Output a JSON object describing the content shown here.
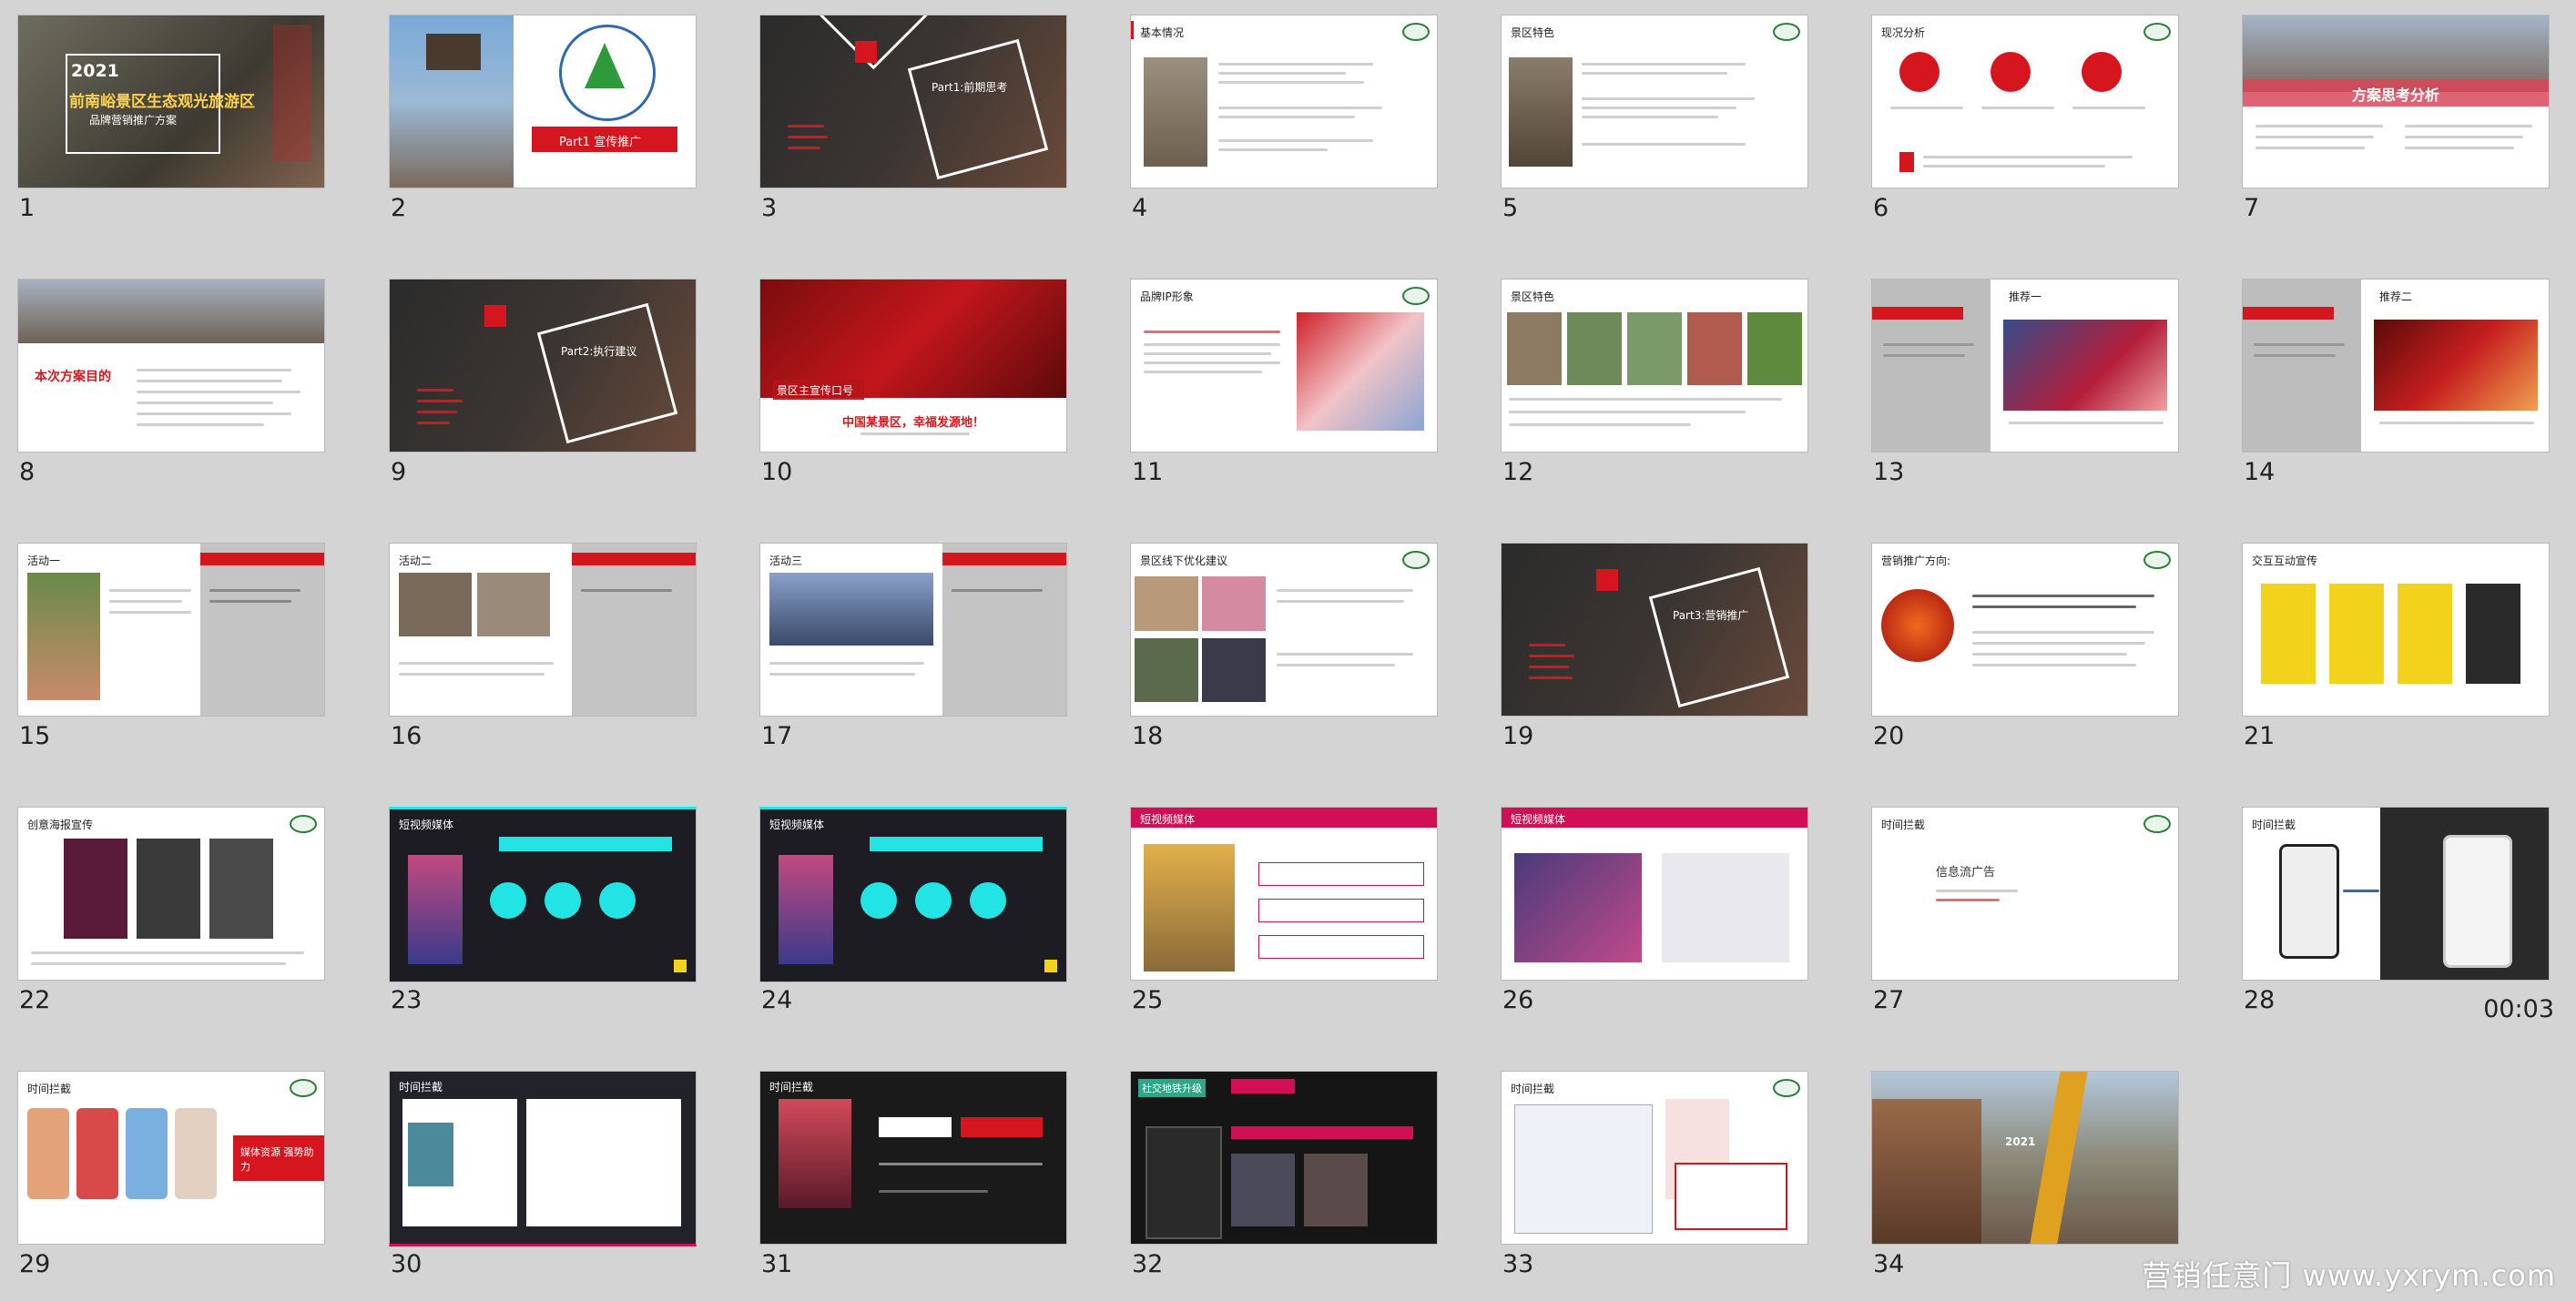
{
  "slides": [
    {
      "number": "1"
    },
    {
      "number": "2"
    },
    {
      "number": "3"
    },
    {
      "number": "4"
    },
    {
      "number": "5"
    },
    {
      "number": "6"
    },
    {
      "number": "7"
    },
    {
      "number": "8"
    },
    {
      "number": "9"
    },
    {
      "number": "10"
    },
    {
      "number": "11"
    },
    {
      "number": "12"
    },
    {
      "number": "13"
    },
    {
      "number": "14"
    },
    {
      "number": "15"
    },
    {
      "number": "16"
    },
    {
      "number": "17"
    },
    {
      "number": "18"
    },
    {
      "number": "19"
    },
    {
      "number": "20"
    },
    {
      "number": "21"
    },
    {
      "number": "22"
    },
    {
      "number": "23"
    },
    {
      "number": "24"
    },
    {
      "number": "25"
    },
    {
      "number": "26"
    },
    {
      "number": "27"
    },
    {
      "number": "28"
    },
    {
      "number": "29"
    },
    {
      "number": "30"
    },
    {
      "number": "31"
    },
    {
      "number": "32"
    },
    {
      "number": "33"
    },
    {
      "number": "34"
    }
  ],
  "timer": "00:03",
  "watermark": "营销任意门 www.yxrym.com",
  "slide_text": {
    "s1_year": "2021",
    "s1_title": "前南峪景区生态观光旅游区",
    "s1_sub": "品牌营销推广方案",
    "s2_tag": "Part1 宣传推广",
    "s3_tag": "Part1:前期思考",
    "s4_title": "基本情况",
    "s5_title": "景区特色",
    "s6_title": "现况分析",
    "s7_title": "方案思考分析",
    "s8_title": "本次方案目的",
    "s9_tag": "Part2:执行建议",
    "s10_label": "景区主宣传口号",
    "s10_slogan": "中国某景区，幸福发源地！",
    "s11_title": "品牌IP形象",
    "s12_title": "景区特色",
    "s13_title": "推荐一",
    "s14_title": "推荐二",
    "s15_title": "活动一",
    "s16_title": "活动二",
    "s17_title": "活动三",
    "s18_title": "景区线下优化建议",
    "s19_tag": "Part3:营销推广",
    "s20_title": "营销推广方向:",
    "s21_title": "交互互动宣传",
    "s22_title": "创意海报宣传",
    "s23_title": "短视频媒体",
    "s24_title": "短视频媒体",
    "s25_title": "短视频媒体",
    "s26_title": "短视频媒体",
    "s27_title": "时间拦截",
    "s27_body": "信息流广告",
    "s28_title": "时间拦截",
    "s29_title": "时间拦截",
    "s29_side": "媒体资源 强势助力",
    "s30_title": "时间拦截",
    "s31_title": "时间拦截",
    "s32_title": "社交地铁升级",
    "s33_title": "时间拦截",
    "s34_year": "2021"
  },
  "colors": {
    "accent_red": "#d6161e",
    "dark": "#2b2b2b",
    "pink": "#d10f55",
    "cyan": "#22e4e4",
    "yellow": "#f2d21a"
  }
}
